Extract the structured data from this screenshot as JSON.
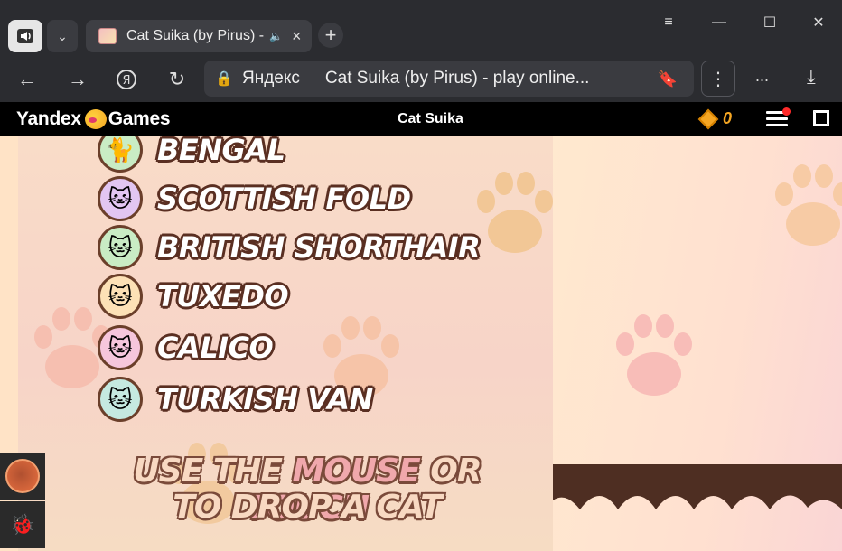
{
  "browser": {
    "tab_title": "Cat Suika (by Pirus) -",
    "address_host": "Яндекс",
    "address_title": "Cat Suika (by Pirus) - play online...",
    "more_label": "...",
    "icons": [
      "volume-icon",
      "chevron-down-icon",
      "audio-icon",
      "close-icon",
      "plus-icon",
      "menu-icon",
      "minimize-icon",
      "maximize-icon",
      "close-window-icon",
      "back-icon",
      "forward-icon",
      "yandex-icon",
      "reload-icon",
      "lock-icon",
      "bookmark-icon",
      "kebab-icon",
      "download-icon"
    ]
  },
  "yandex_bar": {
    "logo_left": "Yandex",
    "logo_right": "Games",
    "game_title": "Cat Suika",
    "coins": "0"
  },
  "game": {
    "cats": [
      {
        "name": "BENGAL",
        "color": "#c9ecc4",
        "emoji": "🐱"
      },
      {
        "name": "SCOTTISH FOLD",
        "color": "#e2c6f2",
        "emoji": "🐱"
      },
      {
        "name": "BRITISH SHORTHAIR",
        "color": "#c9ecc4",
        "emoji": "🐱"
      },
      {
        "name": "TUXEDO",
        "color": "#fde1b6",
        "emoji": "🐱"
      },
      {
        "name": "CALICO",
        "color": "#f6c6dc",
        "emoji": "🐱"
      },
      {
        "name": "TURKISH VAN",
        "color": "#c5e9e0",
        "emoji": "🐱"
      }
    ],
    "instruction": {
      "use_the": "USE THE",
      "mouse": "MOUSE",
      "or": "OR",
      "touch": "TOUCH",
      "line2": "TO DROP A CAT"
    },
    "colors": {
      "outline": "#5a2f22",
      "highlight": "#f0a8ac",
      "wall": "#4e2e22"
    }
  }
}
